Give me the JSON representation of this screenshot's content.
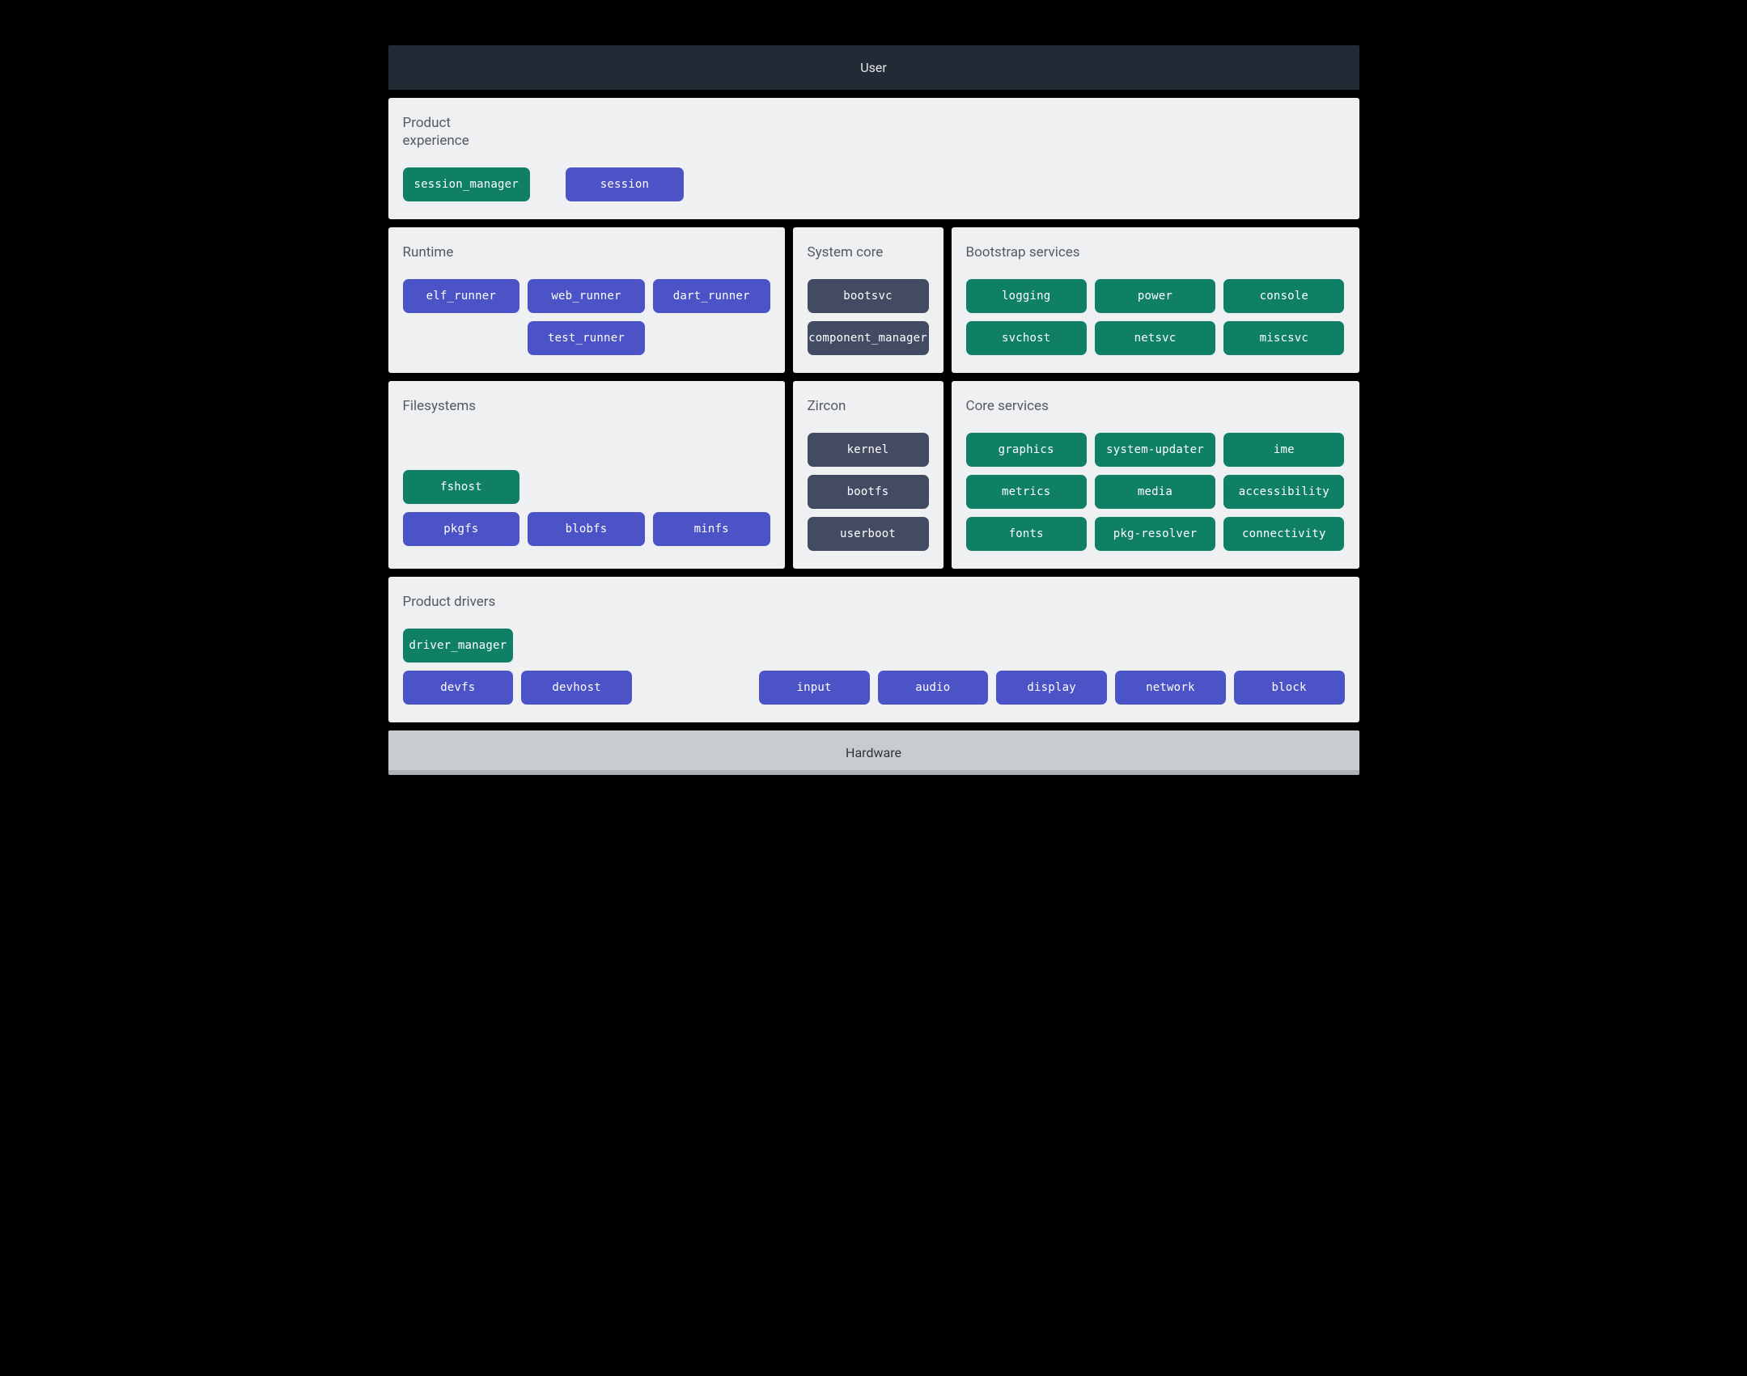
{
  "topBar": {
    "label": "User"
  },
  "product_experience": {
    "title": "Product\nexperience",
    "session_manager": "session_manager",
    "session": "session"
  },
  "runtime": {
    "title": "Runtime",
    "elf_runner": "elf_runner",
    "web_runner": "web_runner",
    "dart_runner": "dart_runner",
    "test_runner": "test_runner"
  },
  "system_core": {
    "title": "System core",
    "bootsvc": "bootsvc",
    "component_manager": "component_manager"
  },
  "bootstrap": {
    "title": "Bootstrap services",
    "logging": "logging",
    "power": "power",
    "console": "console",
    "svchost": "svchost",
    "netsvc": "netsvc",
    "miscsvc": "miscsvc"
  },
  "filesystems": {
    "title": "Filesystems",
    "fshost": "fshost",
    "pkgfs": "pkgfs",
    "blobfs": "blobfs",
    "minfs": "minfs"
  },
  "zircon": {
    "title": "Zircon",
    "kernel": "kernel",
    "bootfs": "bootfs",
    "userboot": "userboot"
  },
  "core_services": {
    "title": "Core services",
    "graphics": "graphics",
    "system_updater": "system-updater",
    "ime": "ime",
    "metrics": "metrics",
    "media": "media",
    "accessibility": "accessibility",
    "fonts": "fonts",
    "pkg_resolver": "pkg-resolver",
    "connectivity": "connectivity"
  },
  "product_drivers": {
    "title": "Product drivers",
    "driver_manager": "driver_manager",
    "devfs": "devfs",
    "devhost": "devhost",
    "input": "input",
    "audio": "audio",
    "display": "display",
    "network": "network",
    "block": "block"
  },
  "bottomBar": {
    "label": "Hardware"
  }
}
